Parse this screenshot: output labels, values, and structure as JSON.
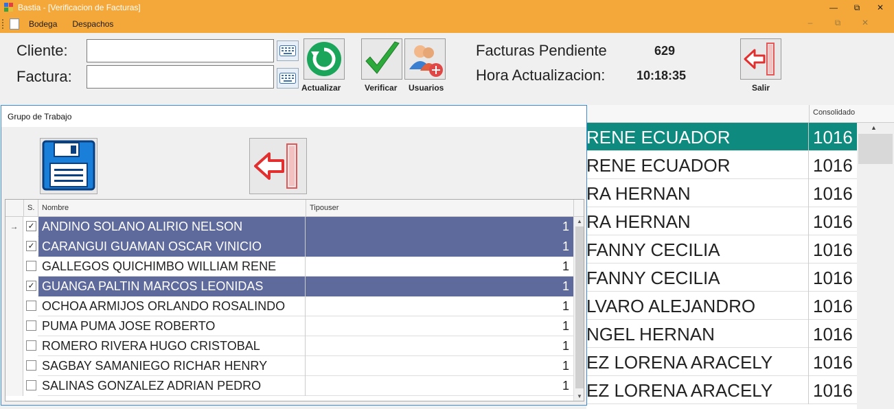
{
  "window": {
    "title": "Bastia - [Verificacion de Facturas]"
  },
  "menu": {
    "items": [
      "Bodega",
      "Despachos"
    ]
  },
  "form": {
    "cliente_label": "Cliente:",
    "factura_label": "Factura:",
    "cliente_value": "",
    "factura_value": ""
  },
  "toolbar": {
    "actualizar": "Actualizar",
    "verificar": "Verificar",
    "usuarios": "Usuarios",
    "salir": "Salir"
  },
  "status": {
    "facturas_label": "Facturas Pendiente",
    "facturas_value": "629",
    "hora_label": "Hora Actualizacion:",
    "hora_value": "10:18:35"
  },
  "bg_grid": {
    "header_consolidado": "Consolidado",
    "rows": [
      {
        "name": "RENE ECUADOR",
        "num": "1016",
        "selected": true
      },
      {
        "name": "RENE ECUADOR",
        "num": "1016"
      },
      {
        "name": "RA HERNAN",
        "num": "1016"
      },
      {
        "name": "RA HERNAN",
        "num": "1016"
      },
      {
        "name": " FANNY CECILIA",
        "num": "1016"
      },
      {
        "name": " FANNY CECILIA",
        "num": "1016"
      },
      {
        "name": "LVARO ALEJANDRO",
        "num": "1016"
      },
      {
        "name": "NGEL HERNAN",
        "num": "1016"
      },
      {
        "name": "EZ LORENA ARACELY",
        "num": "1016"
      },
      {
        "name": "EZ LORENA ARACELY",
        "num": "1016"
      }
    ]
  },
  "dialog": {
    "title": "Grupo de Trabajo",
    "columns": {
      "s": "S.",
      "nombre": "Nombre",
      "tipouser": "Tipouser"
    },
    "rows": [
      {
        "nombre": "ANDINO SOLANO ALIRIO NELSON",
        "tipouser": "1",
        "checked": true,
        "selected": true,
        "current": true
      },
      {
        "nombre": "CARANGUI GUAMAN OSCAR VINICIO",
        "tipouser": "1",
        "checked": true,
        "selected": true
      },
      {
        "nombre": "GALLEGOS QUICHIMBO WILLIAM RENE",
        "tipouser": "1",
        "checked": false
      },
      {
        "nombre": "GUANGA PALTIN MARCOS LEONIDAS",
        "tipouser": "1",
        "checked": true,
        "selected": true
      },
      {
        "nombre": "OCHOA ARMIJOS ORLANDO ROSALINDO",
        "tipouser": "1",
        "checked": false
      },
      {
        "nombre": "PUMA PUMA JOSE ROBERTO",
        "tipouser": "1",
        "checked": false
      },
      {
        "nombre": "ROMERO RIVERA HUGO CRISTOBAL",
        "tipouser": "1",
        "checked": false
      },
      {
        "nombre": "SAGBAY SAMANIEGO RICHAR HENRY",
        "tipouser": "1",
        "checked": false
      },
      {
        "nombre": "SALINAS GONZALEZ ADRIAN PEDRO",
        "tipouser": "1",
        "checked": false
      }
    ]
  },
  "colors": {
    "titlebar": "#f5a83a",
    "selected_row": "#5f6a9c",
    "bg_selected_row": "#0f8a7e"
  }
}
